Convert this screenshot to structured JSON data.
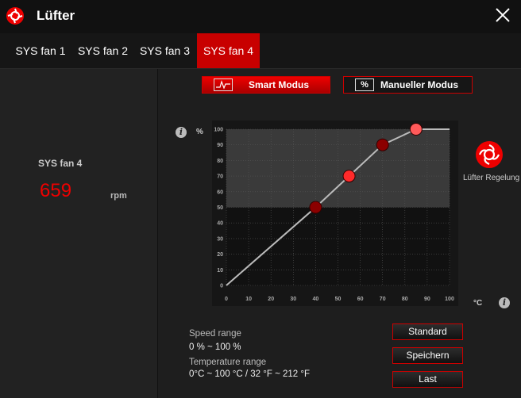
{
  "window": {
    "title": "Lüfter"
  },
  "tabs": [
    {
      "label": "SYS fan 1"
    },
    {
      "label": "SYS fan 2"
    },
    {
      "label": "SYS fan 3"
    },
    {
      "label": "SYS fan 4",
      "active": true
    }
  ],
  "fan": {
    "name": "SYS fan 4",
    "rpm": "659",
    "rpm_unit": "rpm"
  },
  "modes": {
    "smart": "Smart Modus",
    "manual": "Manueller Modus",
    "manual_icon": "%"
  },
  "chart": {
    "y_unit": "%",
    "x_unit": "°C",
    "regel_label": "Lüfter Regelung"
  },
  "chart_data": {
    "type": "line",
    "x_ticks": [
      0,
      10,
      20,
      30,
      40,
      50,
      60,
      70,
      80,
      90,
      100
    ],
    "y_ticks": [
      0,
      10,
      20,
      30,
      40,
      50,
      60,
      70,
      80,
      90,
      100
    ],
    "xlim": [
      0,
      100
    ],
    "ylim": [
      0,
      100
    ],
    "series": [
      {
        "x": [
          0,
          40,
          55,
          70,
          85,
          100
        ],
        "y": [
          0,
          50,
          70,
          90,
          100,
          100
        ]
      }
    ],
    "points": [
      {
        "x": 40,
        "y": 50,
        "color": "#8b0000"
      },
      {
        "x": 55,
        "y": 70,
        "color": "#ff2a2a"
      },
      {
        "x": 70,
        "y": 90,
        "color": "#8b0000"
      },
      {
        "x": 85,
        "y": 100,
        "color": "#ff5a5a"
      }
    ],
    "highlight_band": [
      50,
      100
    ],
    "grid": true
  },
  "info": {
    "speed_label": "Speed range",
    "speed_value": "0 % ~ 100 %",
    "temp_label": "Temperature range",
    "temp_value": "0°C ~ 100 °C / 32 °F ~ 212 °F"
  },
  "buttons": {
    "standard": "Standard",
    "save": "Speichern",
    "last": "Last"
  },
  "colors": {
    "accent": "#c80000",
    "background": "#1b1b1b"
  }
}
